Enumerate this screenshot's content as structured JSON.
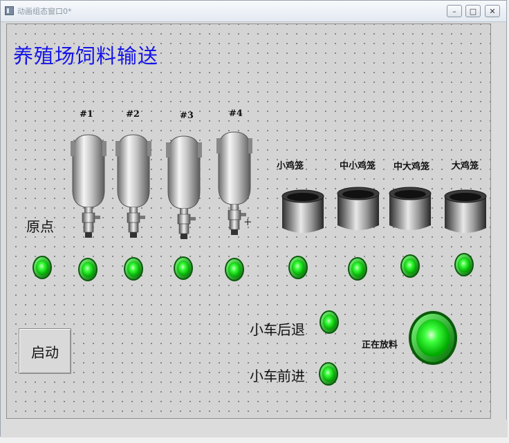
{
  "window": {
    "title": "动画组态窗口0*",
    "controls": [
      "minimize-icon",
      "maximize-icon",
      "close-icon"
    ]
  },
  "heading": "养殖场饲料输送",
  "origin_label": "原点",
  "tanks": [
    {
      "label": "#1"
    },
    {
      "label": "#2"
    },
    {
      "label": "#3"
    },
    {
      "label": "#4"
    }
  ],
  "cages": [
    {
      "label": "小鸡笼"
    },
    {
      "label": "中小鸡笼"
    },
    {
      "label": "中大鸡笼"
    },
    {
      "label": "大鸡笼"
    }
  ],
  "indicators": {
    "reverse_label": "小车后退",
    "forward_label": "小车前进",
    "dispensing_label": "正在放料"
  },
  "start_button": "启动",
  "colors": {
    "heading": "#1515e8",
    "lamp_green": "#19d419",
    "canvas_bg": "#d4d4d4"
  }
}
